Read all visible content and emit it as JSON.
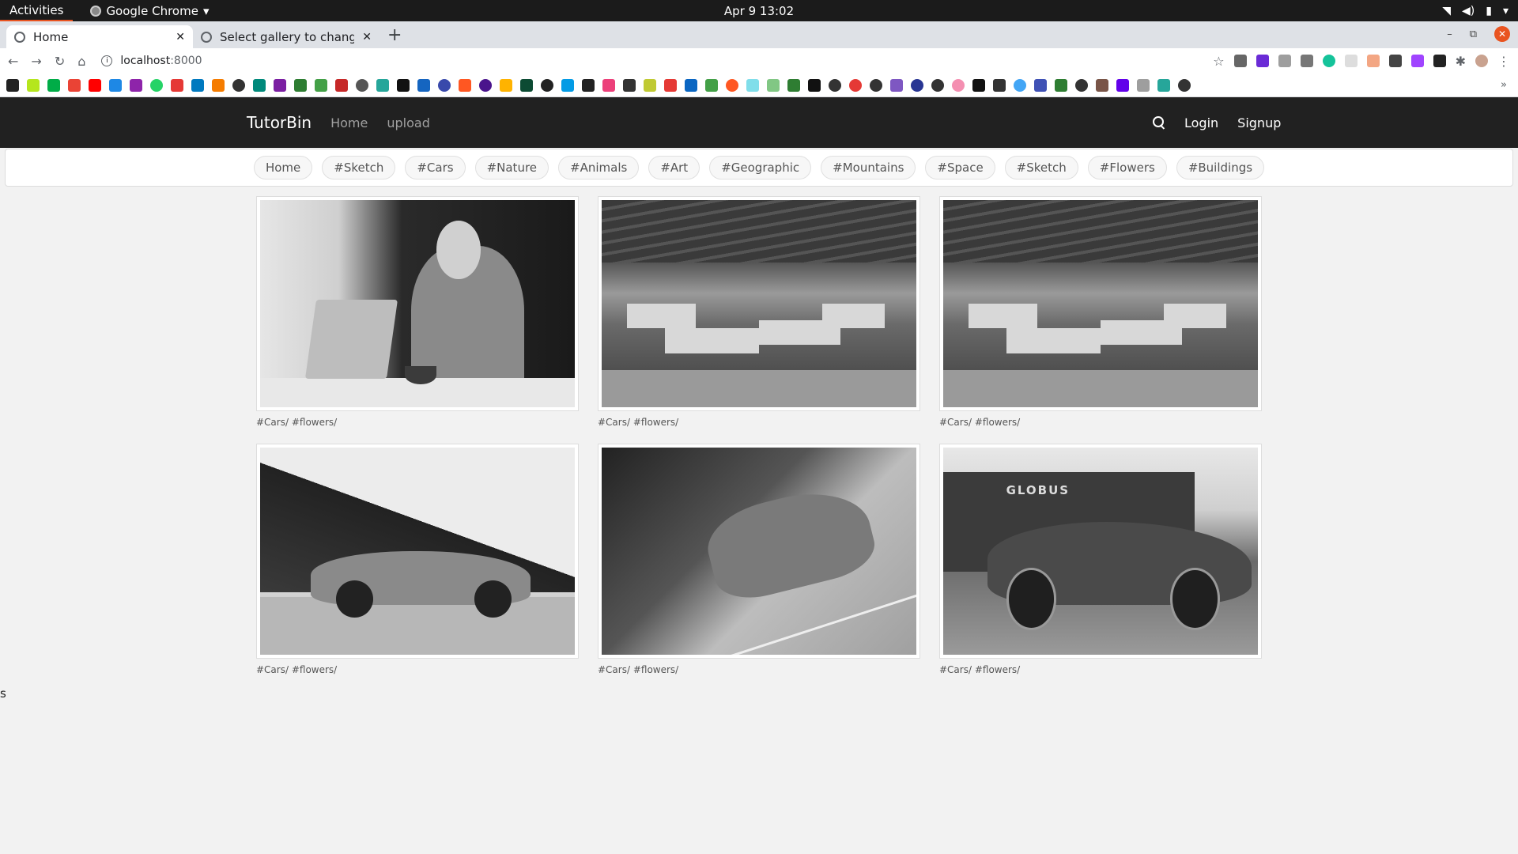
{
  "os_bar": {
    "activities": "Activities",
    "app_name": "Google Chrome",
    "clock": "Apr 9  13:02"
  },
  "browser": {
    "tabs": [
      {
        "title": "Home",
        "active": true
      },
      {
        "title": "Select gallery to change | ",
        "active": false
      }
    ],
    "url_host": "localhost",
    "url_port": ":8000"
  },
  "site": {
    "brand": "TutorBin",
    "nav": {
      "home": "Home",
      "upload": "upload"
    },
    "auth": {
      "login": "Login",
      "signup": "Signup"
    },
    "tags": [
      "Home",
      "#Sketch",
      "#Cars",
      "#Nature",
      "#Animals",
      "#Art",
      "#Geographic",
      "#Mountains",
      "#Space",
      "#Sketch",
      "#Flowers",
      "#Buildings"
    ],
    "gallery": [
      {
        "caption": "#Cars/ #flowers/",
        "image": "man-with-laptop-photo"
      },
      {
        "caption": "#Cars/ #flowers/",
        "image": "office-photo"
      },
      {
        "caption": "#Cars/ #flowers/",
        "image": "office-photo"
      },
      {
        "caption": "#Cars/ #flowers/",
        "image": "car-side-photo"
      },
      {
        "caption": "#Cars/ #flowers/",
        "image": "car-front-photo"
      },
      {
        "caption": "#Cars/ #flowers/",
        "image": "sports-car-photo",
        "sign_text": "GLOBUS"
      }
    ]
  },
  "stray_text": "s",
  "colors": {
    "navbar": "#212121",
    "accent": "#e95420",
    "page_bg": "#f2f2f2"
  }
}
